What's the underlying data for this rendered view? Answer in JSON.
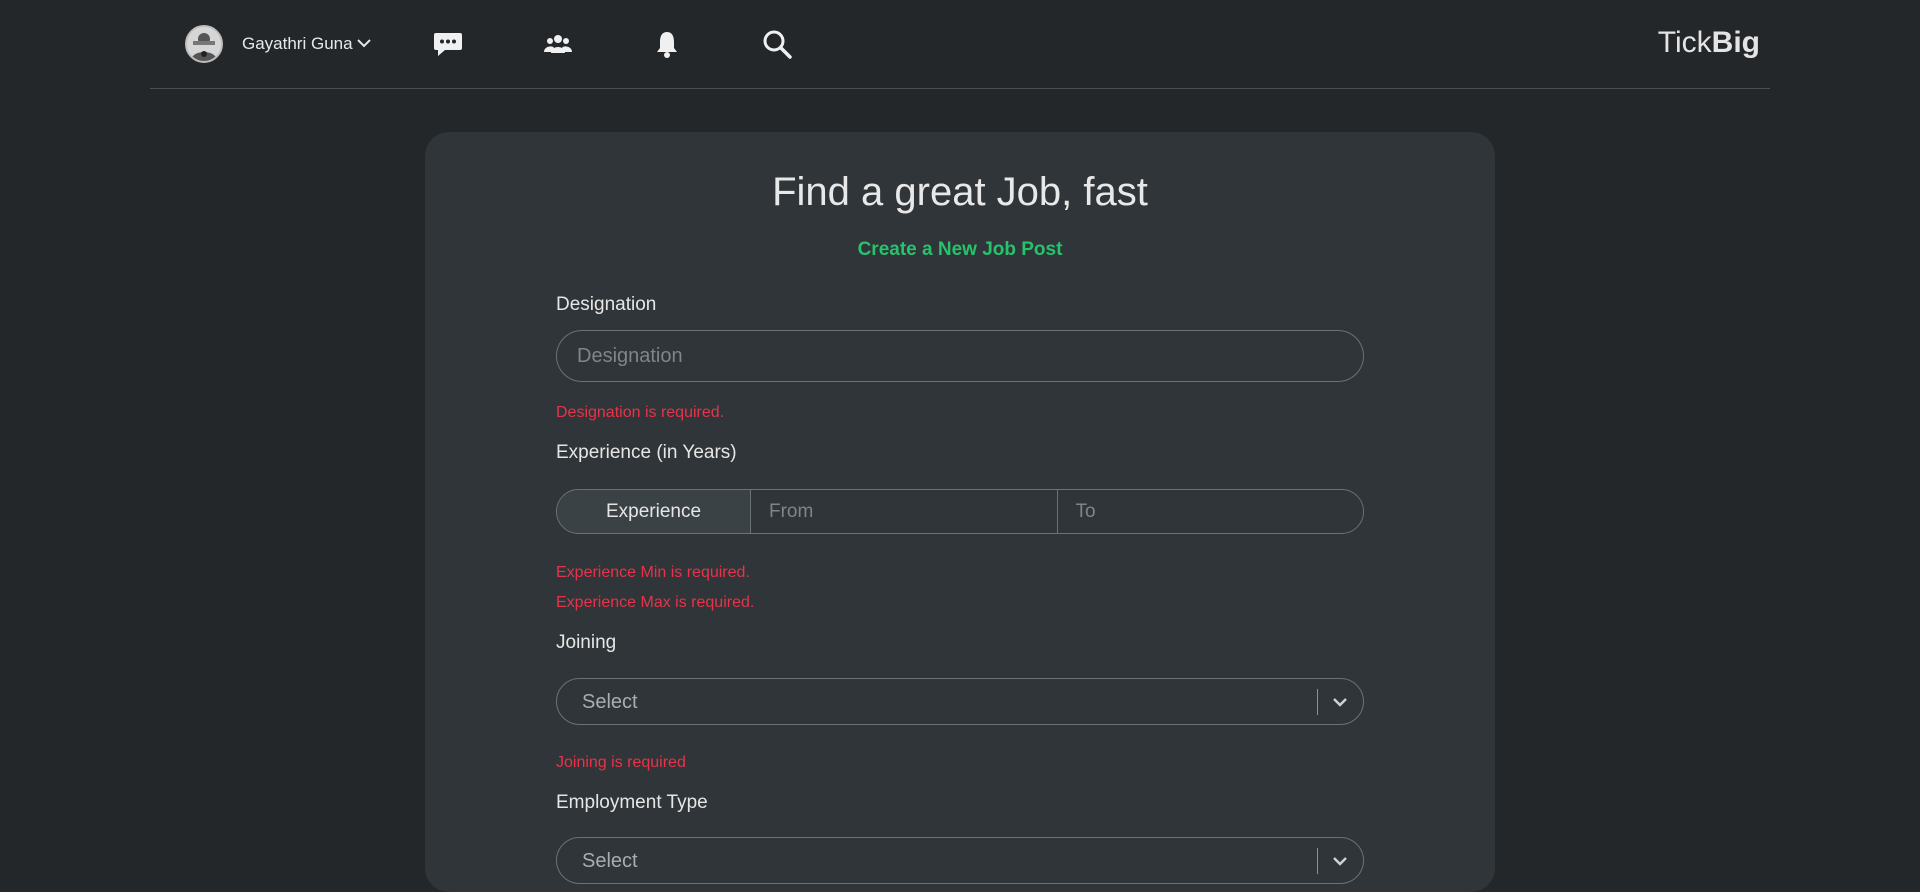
{
  "header": {
    "user_name": "Gayathri Guna",
    "brand_light": "Tick",
    "brand_bold": "Big"
  },
  "icons": [
    "avatar-icon",
    "chevron-down-icon",
    "chat-icon",
    "users-icon",
    "bell-icon",
    "search-icon"
  ],
  "form": {
    "title": "Find a great Job, fast",
    "create_link": "Create a New Job Post",
    "designation": {
      "label": "Designation",
      "placeholder": "Designation",
      "value": "",
      "error": "Designation is required."
    },
    "experience": {
      "label": "Experience (in Years)",
      "tag": "Experience",
      "from_placeholder": "From",
      "to_placeholder": "To",
      "error_min": "Experience Min is required.",
      "error_max": "Experience Max is required."
    },
    "joining": {
      "label": "Joining",
      "selected": "Select",
      "error": "Joining is required"
    },
    "employment_type": {
      "label": "Employment Type",
      "selected": "Select"
    }
  },
  "colors": {
    "background": "#23272a",
    "card": "#2f3538",
    "accent_green": "#27c26c",
    "error_red": "#e8334a"
  }
}
